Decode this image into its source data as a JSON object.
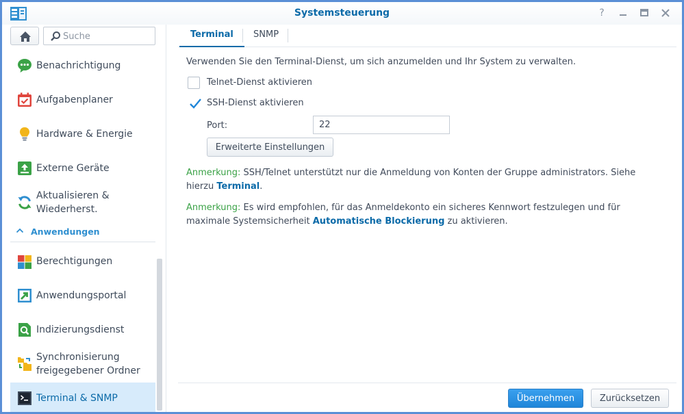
{
  "window": {
    "title": "Systemsteuerung",
    "controls": [
      "help-icon",
      "minimize-icon",
      "maximize-icon",
      "close-icon"
    ]
  },
  "sidebar": {
    "search_placeholder": "Suche",
    "items": [
      {
        "label": "Benachrichtigung",
        "icon": "chat-bubble-icon",
        "color": "#3ba247"
      },
      {
        "label": "Aufgabenplaner",
        "icon": "calendar-check-icon",
        "color": "#e0453d"
      },
      {
        "label": "Hardware & Energie",
        "icon": "lightbulb-icon",
        "color": "#f2b51a"
      },
      {
        "label": "Externe Geräte",
        "icon": "upload-icon",
        "color": "#3ba247"
      },
      {
        "label": "Aktualisieren & Wiederherst.",
        "icon": "refresh-icon",
        "color": "#2f8fd0"
      }
    ],
    "section": {
      "label": "Anwendungen",
      "icon": "chevron-up-icon"
    },
    "app_items": [
      {
        "label": "Berechtigungen",
        "icon": "tiles-icon"
      },
      {
        "label": "Anwendungsportal",
        "icon": "arrow-portal-icon"
      },
      {
        "label": "Indizierungsdienst",
        "icon": "search-doc-icon"
      },
      {
        "label": "Synchronisierung freigegebener Ordner",
        "icon": "sync-folder-icon"
      },
      {
        "label": "Terminal & SNMP",
        "icon": "terminal-icon",
        "active": true
      }
    ]
  },
  "tabs": [
    {
      "label": "Terminal",
      "active": true
    },
    {
      "label": "SNMP",
      "active": false
    }
  ],
  "terminal": {
    "description": "Verwenden Sie den Terminal-Dienst, um sich anzumelden und Ihr System zu verwalten.",
    "telnet_label": "Telnet-Dienst aktivieren",
    "telnet_checked": false,
    "ssh_label": "SSH-Dienst aktivieren",
    "ssh_checked": true,
    "port_label": "Port:",
    "port_value": "22",
    "advanced_button": "Erweiterte Einstellungen",
    "note1": {
      "prefix": "Anmerkung:",
      "text": " SSH/Telnet unterstützt nur die Anmeldung von Konten der Gruppe administrators. Siehe hierzu ",
      "link": "Terminal",
      "suffix": "."
    },
    "note2": {
      "prefix": "Anmerkung:",
      "text": " Es wird empfohlen, für das Anmeldekonto ein sicheres Kennwort festzulegen und für maximale Systemsicherheit ",
      "link": "Automatische Blockierung",
      "suffix": " zu aktivieren."
    }
  },
  "footer": {
    "apply_label": "Übernehmen",
    "reset_label": "Zurücksetzen"
  },
  "colors": {
    "accent": "#0b6aa8",
    "note_green": "#3ba247",
    "active_bg": "#d7ebfb",
    "window_border": "#5b8fd6"
  }
}
